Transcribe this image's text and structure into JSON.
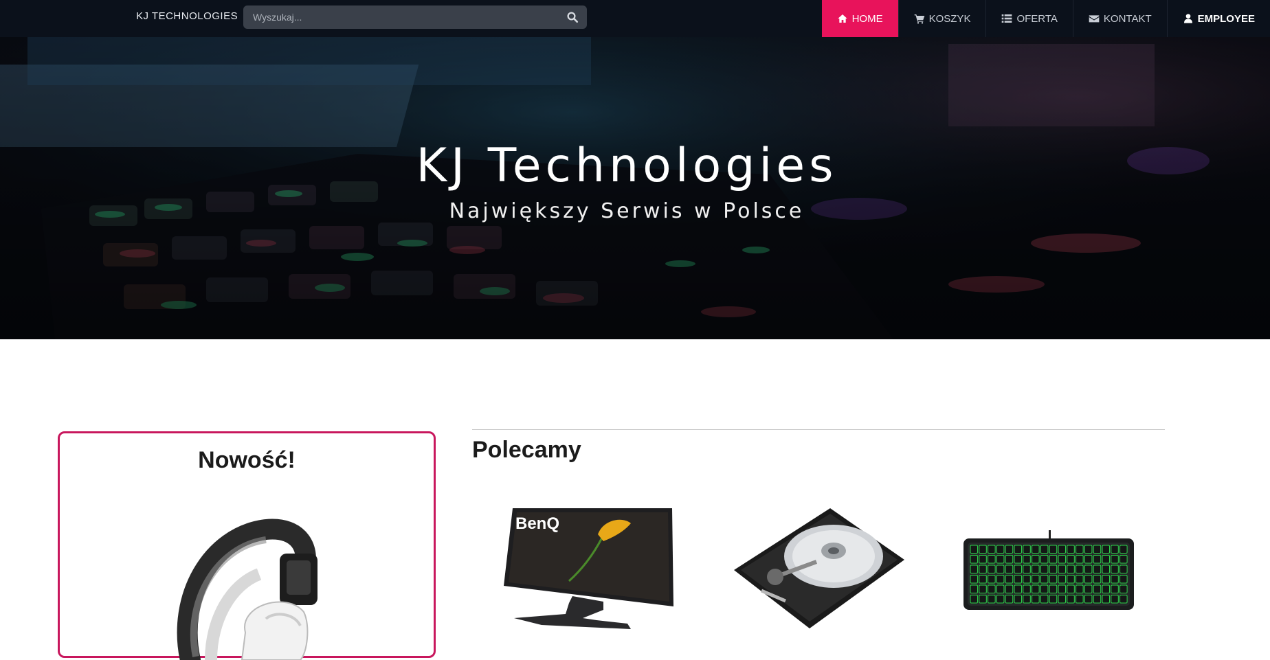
{
  "navbar": {
    "brand": "KJ TECHNOLOGIES",
    "search_placeholder": "Wyszukaj...",
    "items": [
      {
        "label": "HOME",
        "icon": "home-icon",
        "active": true
      },
      {
        "label": "KOSZYK",
        "icon": "cart-icon"
      },
      {
        "label": "OFERTA",
        "icon": "list-icon"
      },
      {
        "label": "KONTAKT",
        "icon": "envelope-icon"
      },
      {
        "label": "EMPLOYEE",
        "icon": "user-icon"
      }
    ]
  },
  "hero": {
    "title": "KJ Technologies",
    "subtitle": "Największy Serwis w Polsce"
  },
  "new_box": {
    "title": "Nowość!"
  },
  "recommended": {
    "title": "Polecamy",
    "products": [
      {
        "name": "monitor",
        "brand_text": "BenQ"
      },
      {
        "name": "hard-drive"
      },
      {
        "name": "keyboard"
      }
    ]
  },
  "colors": {
    "accent": "#e8135b",
    "navbar_bg": "#0b111b",
    "new_box_border": "#c8175d"
  }
}
